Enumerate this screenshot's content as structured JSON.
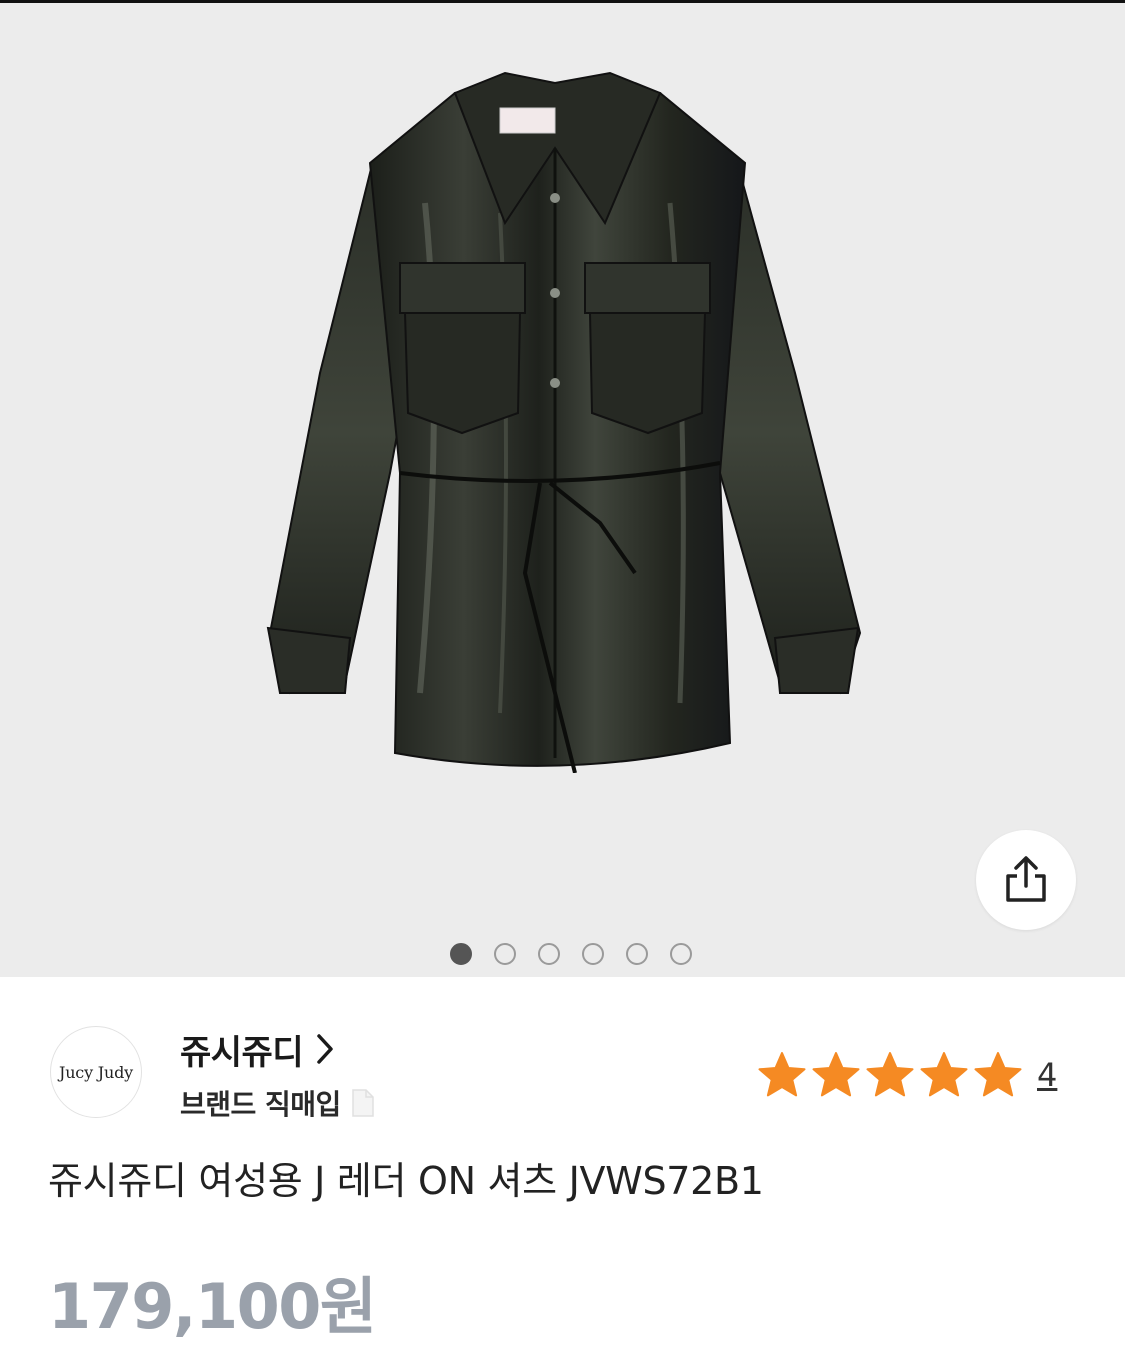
{
  "gallery": {
    "image_subject": "black patent leather shirt jacket",
    "slide_count": 6,
    "active_slide": 1,
    "background": "#ececec"
  },
  "brand": {
    "logo_text": "Jucy Judy",
    "name": "쥬시쥬디",
    "chevron": ">",
    "subtitle": "브랜드 직매입",
    "subtitle_icon": "document-icon"
  },
  "rating": {
    "stars": 5,
    "star_color": "#f58a23",
    "review_count": "4"
  },
  "product": {
    "title": "쥬시쥬디 여성용 J 레더 ON 셔츠 JVWS72B1",
    "price": "179,100원"
  },
  "icons": {
    "share": "share-icon"
  }
}
